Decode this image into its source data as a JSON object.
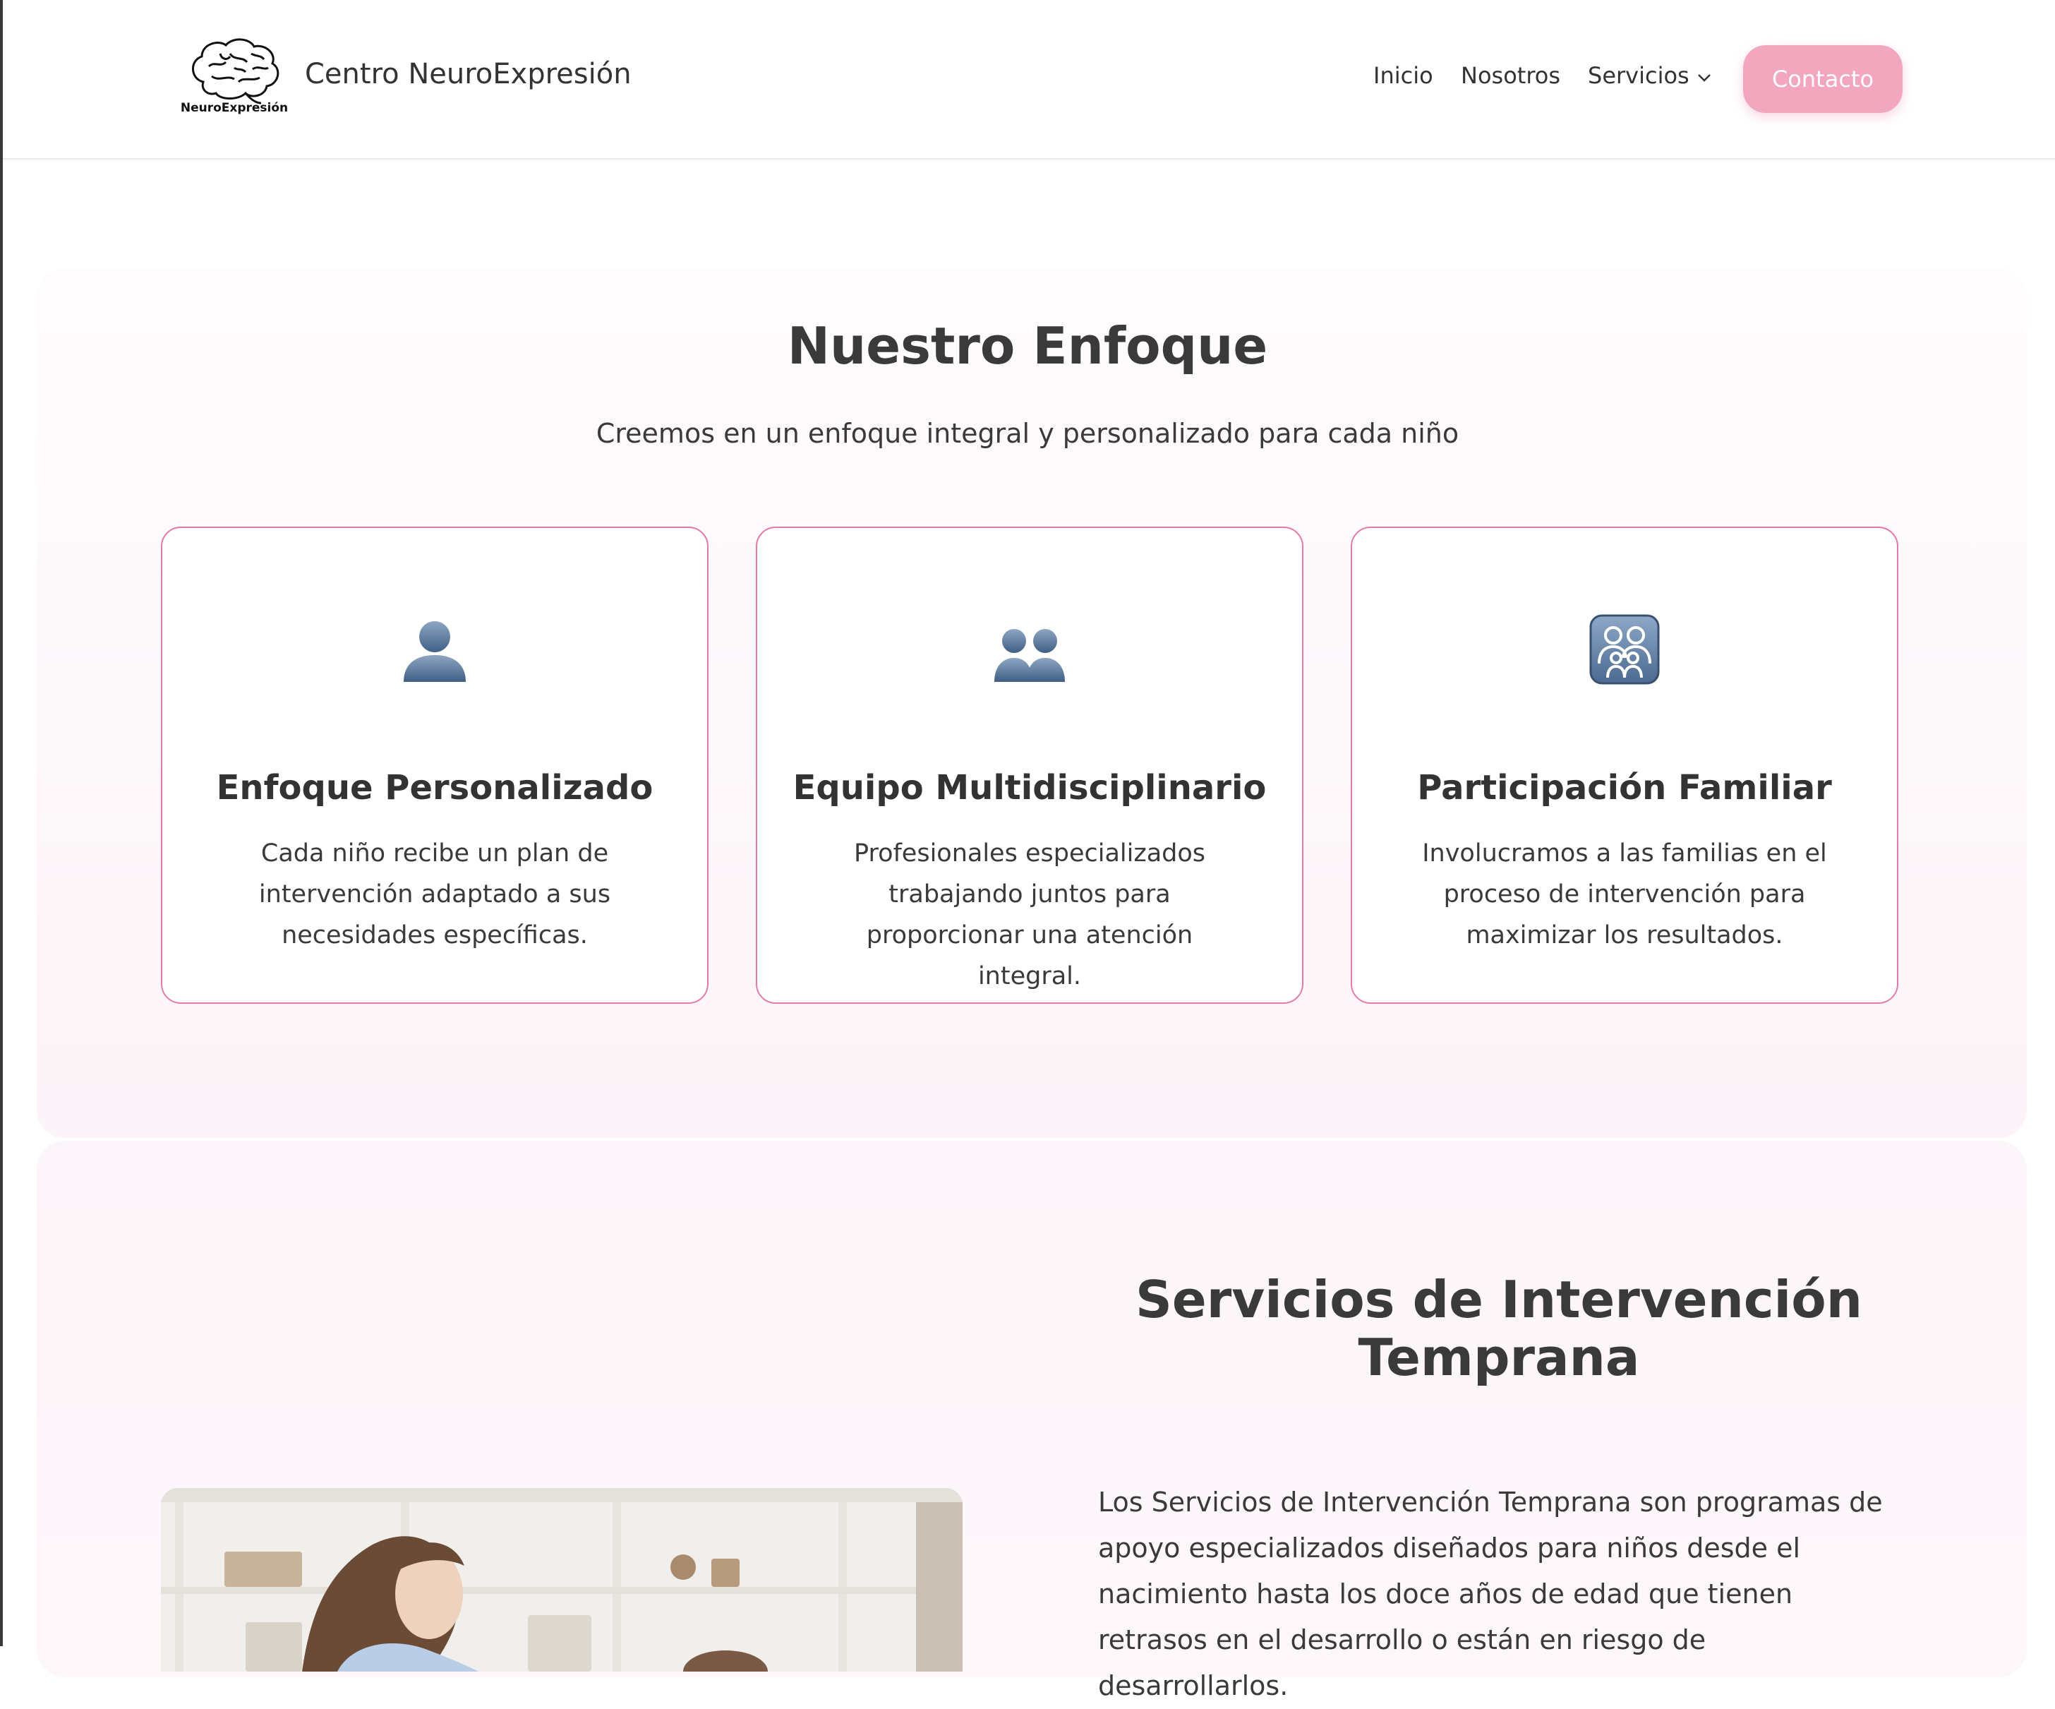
{
  "header": {
    "logo_caption": "NeuroExpresión",
    "brand_name": "Centro NeuroExpresión",
    "nav": [
      {
        "label": "Inicio"
      },
      {
        "label": "Nosotros"
      },
      {
        "label": "Servicios"
      }
    ],
    "dropdown_icon": "chevron-down-icon",
    "contact_label": "Contacto",
    "accent_color": "#f2a7bf"
  },
  "enfoque": {
    "title": "Nuestro Enfoque",
    "subtitle": "Creemos en un enfoque integral y personalizado para cada niño",
    "cards": [
      {
        "icon": "person-silhouette-icon",
        "title": "Enfoque Personalizado",
        "text": "Cada niño recibe un plan de intervención adaptado a sus necesidades específicas."
      },
      {
        "icon": "two-people-silhouette-icon",
        "title": "Equipo Multidisciplinario",
        "text": "Profesionales especializados trabajando juntos para proporcionar una atención integral."
      },
      {
        "icon": "family-icon",
        "title": "Participación Familiar",
        "text": "Involucramos a las familias en el proceso de intervención para maximizar los resultados."
      }
    ],
    "card_border_color": "#e37aa9"
  },
  "servicios": {
    "title": "Servicios de Intervención Temprana",
    "text": "Los Servicios de Intervención Temprana son programas de apoyo especializados diseñados para niños desde el nacimiento hasta los doce años de edad que tienen retrasos en el desarrollo o están en riesgo de desarrollarlos."
  }
}
